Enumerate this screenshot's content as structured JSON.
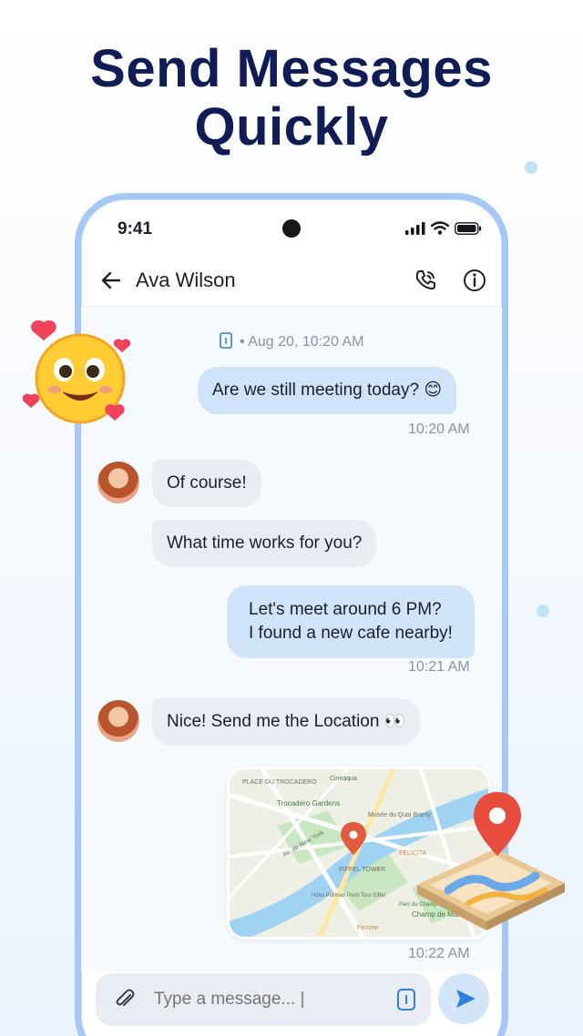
{
  "headline": {
    "line1": "Send Messages",
    "line2": "Quickly"
  },
  "status_bar": {
    "time": "9:41"
  },
  "header": {
    "contact_name": "Ava Wilson"
  },
  "chat": {
    "date_label": "• Aug 20, 10:20 AM",
    "messages": [
      {
        "direction": "out",
        "text": "Are we still meeting today? 😊",
        "time": "10:20 AM"
      },
      {
        "direction": "in",
        "text": "Of course!"
      },
      {
        "direction": "in",
        "text": "What time works for you?"
      },
      {
        "direction": "out",
        "line1": "Let's meet around 6 PM?",
        "line2": "I found a new cafe nearby!",
        "time": "10:21 AM"
      },
      {
        "direction": "in",
        "text": "Nice! Send me the Location 👀"
      },
      {
        "direction": "out",
        "type": "map",
        "time": "10:22 AM"
      }
    ]
  },
  "map_labels": {
    "label1": "PLACE DU TROCADERO",
    "label2": "Trocadéro Gardens",
    "label3": "Musée du Quai Branly",
    "label4": "EIFFEL TOWER",
    "label5": "FELICITA",
    "label6": "Champ de Mars",
    "label7": "Firmine",
    "label8": "Cinéaqua",
    "label9": "Av. de New York",
    "label10": "Hôtel Pullman Paris Tour Eiffel",
    "label11": "Parc du Champ de Mars"
  },
  "composer": {
    "placeholder": "Type a message... |"
  },
  "colors": {
    "headline": "#101c56",
    "phone_frame": "#a7c8f5",
    "outgoing_bubble": "#cfe4f8",
    "incoming_bubble": "#e9edf3",
    "send_icon": "#2f7fe0"
  },
  "icons": {
    "back": "arrow-left-icon",
    "call": "phone-icon",
    "info": "info-icon",
    "attach": "paperclip-icon",
    "file": "file-icon",
    "send": "send-icon"
  }
}
